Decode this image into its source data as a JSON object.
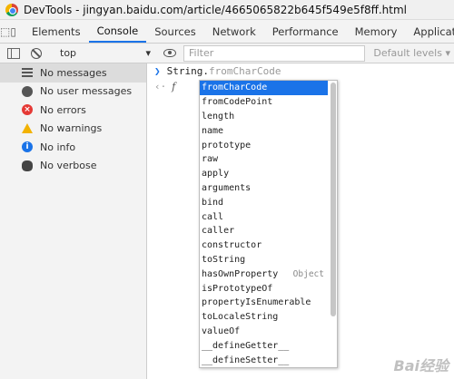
{
  "window": {
    "title": "DevTools - jingyan.baidu.com/article/4665065822b645f549e5f8ff.html"
  },
  "tabs": [
    {
      "label": "Elements"
    },
    {
      "label": "Console",
      "active": true
    },
    {
      "label": "Sources"
    },
    {
      "label": "Network"
    },
    {
      "label": "Performance"
    },
    {
      "label": "Memory"
    },
    {
      "label": "Application"
    }
  ],
  "toolbar": {
    "context": "top",
    "filter_placeholder": "Filter",
    "levels": "Default levels ▾"
  },
  "sidebar": {
    "items": [
      {
        "label": "No messages",
        "icon": "list-icon",
        "selected": true
      },
      {
        "label": "No user messages",
        "icon": "user-icon"
      },
      {
        "label": "No errors",
        "icon": "error-icon"
      },
      {
        "label": "No warnings",
        "icon": "warning-icon"
      },
      {
        "label": "No info",
        "icon": "info-icon"
      },
      {
        "label": "No verbose",
        "icon": "bug-icon"
      }
    ]
  },
  "console": {
    "typed": "String.",
    "completion_hint": "fromCharCode",
    "result_glyph": "f"
  },
  "autocomplete": {
    "items": [
      {
        "label": "fromCharCode",
        "selected": true
      },
      {
        "label": "fromCodePoint"
      },
      {
        "label": "length"
      },
      {
        "label": "name"
      },
      {
        "label": "prototype"
      },
      {
        "label": "raw"
      },
      {
        "label": "apply"
      },
      {
        "label": "arguments"
      },
      {
        "label": "bind"
      },
      {
        "label": "call"
      },
      {
        "label": "caller"
      },
      {
        "label": "constructor"
      },
      {
        "label": "toString"
      },
      {
        "label": "hasOwnProperty",
        "type": "Object"
      },
      {
        "label": "isPrototypeOf"
      },
      {
        "label": "propertyIsEnumerable"
      },
      {
        "label": "toLocaleString"
      },
      {
        "label": "valueOf"
      },
      {
        "label": "__defineGetter__"
      },
      {
        "label": "__defineSetter__"
      }
    ]
  },
  "watermark": "Bai经验",
  "colors": {
    "accent": "#1a73e8",
    "error": "#e53935",
    "warning": "#f2b200"
  }
}
